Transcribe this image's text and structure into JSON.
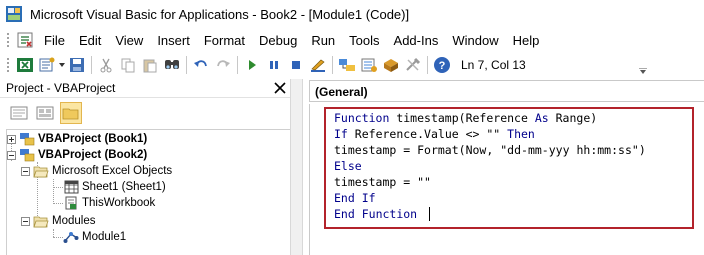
{
  "window": {
    "title": "Microsoft Visual Basic for Applications - Book2 - [Module1 (Code)]"
  },
  "menubar": {
    "items": [
      "File",
      "Edit",
      "View",
      "Insert",
      "Format",
      "Debug",
      "Run",
      "Tools",
      "Add-Ins",
      "Window",
      "Help"
    ]
  },
  "toolbar": {
    "buttons": [
      "excel-view-icon",
      "insert-module-icon",
      "save-icon",
      "cut-icon",
      "copy-icon",
      "paste-icon",
      "find-icon",
      "undo-icon",
      "redo-icon",
      "run-icon",
      "break-icon",
      "reset-icon",
      "design-mode-icon",
      "project-explorer-icon",
      "properties-icon",
      "object-browser-icon",
      "toolbox-icon",
      "help-icon"
    ],
    "position_label": "Ln 7, Col 13"
  },
  "project_panel": {
    "title": "Project - VBAProject",
    "tree": {
      "project1": "VBAProject (Book1)",
      "project2": "VBAProject (Book2)",
      "excel_objects": "Microsoft Excel Objects",
      "sheet1": "Sheet1 (Sheet1)",
      "thisworkbook": "ThisWorkbook",
      "modules": "Modules",
      "module1": "Module1"
    }
  },
  "code_pane": {
    "object_dropdown": "(General)",
    "lines": [
      "Function timestamp(Reference As Range)",
      "If Reference.Value <> \"\" Then",
      "timestamp = Format(Now, \"dd-mm-yyy hh:mm:ss\")",
      "Else",
      "timestamp = \"\"",
      "End If",
      "End Function"
    ],
    "keywords": [
      "Function",
      "As",
      "If",
      "Then",
      "Else",
      "End"
    ],
    "colors": {
      "keyword": "#00008b",
      "highlight_border": "#b3232b",
      "text": "#000000"
    }
  }
}
